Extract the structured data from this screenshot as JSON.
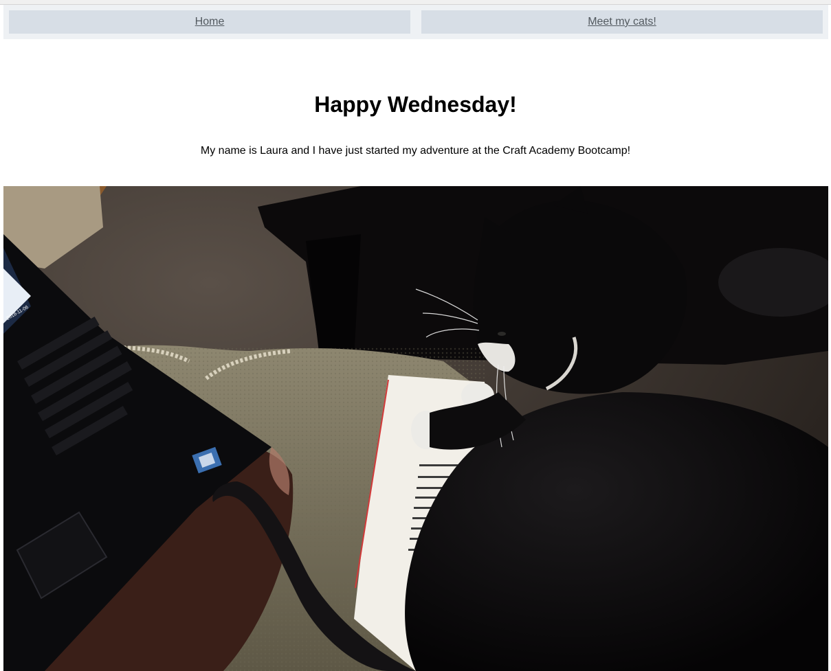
{
  "nav": {
    "home_label": "Home",
    "cats_label": "Meet my cats!"
  },
  "main": {
    "heading": "Happy Wednesday!",
    "intro_text": "My name is Laura and I have just started my adventure at the Craft Academy Bootcamp!"
  },
  "photo": {
    "subject": "black-and-white cat lying on a book next to a laptop",
    "laptop_date": "2018-11-06"
  },
  "colors": {
    "nav_bg": "#eef1f4",
    "nav_button_bg": "#d7dee6",
    "nav_link_text": "#52595f"
  }
}
